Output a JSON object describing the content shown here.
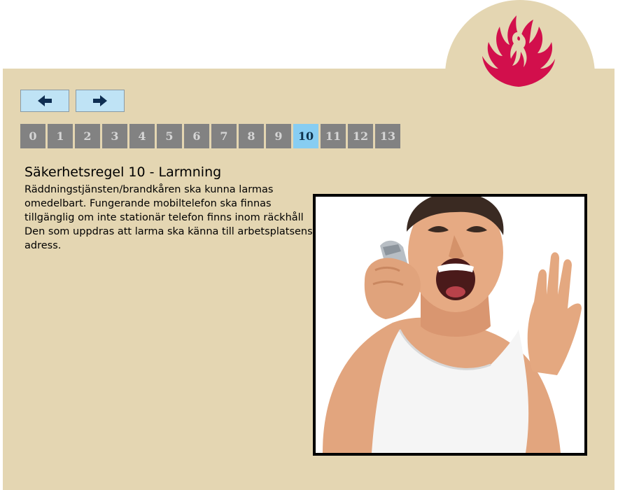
{
  "navigation": {
    "prev_icon": "arrow-left-icon",
    "next_icon": "arrow-right-icon"
  },
  "pager": {
    "pages": [
      "0",
      "1",
      "2",
      "3",
      "4",
      "5",
      "6",
      "7",
      "8",
      "9",
      "10",
      "11",
      "12",
      "13"
    ],
    "active_page": "10"
  },
  "rule": {
    "title": "Säkerhetsregel 10 - Larmning",
    "lines": [
      "Räddningstjänsten/brandkåren ska kunna larmas",
      "omedelbart. Fungerande mobiltelefon ska finnas",
      "tillgänglig om inte stationär telefon finns inom räckhåll",
      "Den som uppdras att larma ska känna till arbetsplatsens",
      "adress."
    ]
  },
  "colors": {
    "panel": "#e4d6b2",
    "logo": "#d20f4c",
    "nav_button": "#bfe3f5",
    "page_button": "#828282",
    "page_button_active": "#87cdf2"
  },
  "logo_icon": "phoenix-flame-icon",
  "photo_icon": "man-shouting-into-phone-image"
}
